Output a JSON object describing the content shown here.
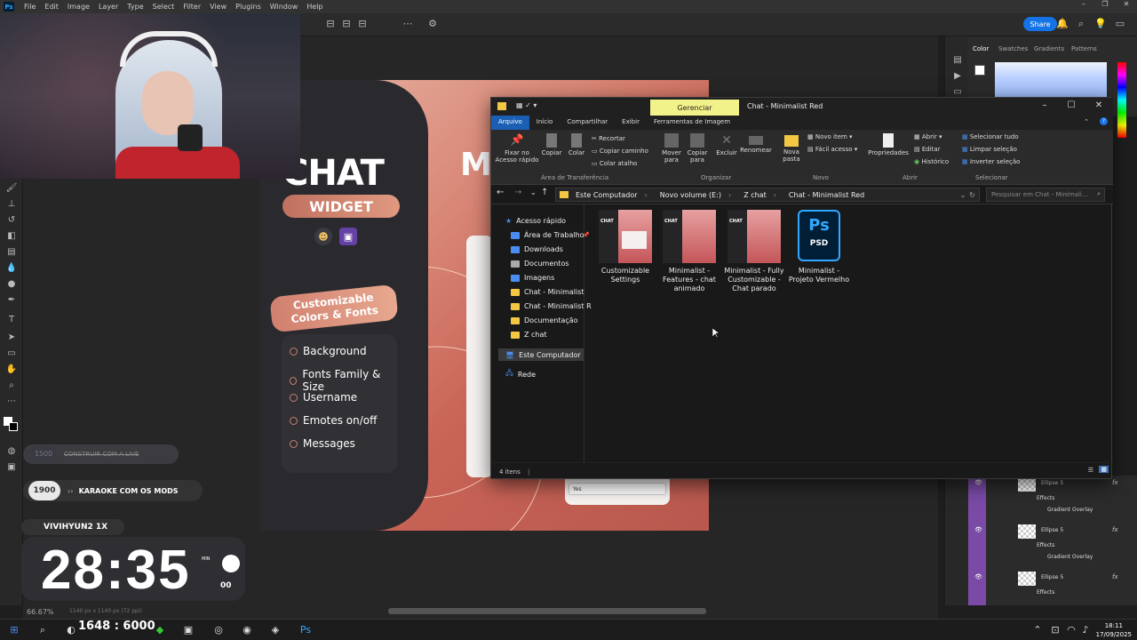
{
  "photoshop": {
    "menu": [
      "File",
      "Edit",
      "Image",
      "Layer",
      "Type",
      "Select",
      "Filter",
      "View",
      "Plugins",
      "Window",
      "Help"
    ],
    "logo": "Ps",
    "share_label": "Share",
    "panel_tabs": [
      "Color",
      "Swatches",
      "Gradients",
      "Patterns"
    ],
    "status_zoom": "66.67%",
    "status_doc": "1140 px x 1140 px (72 ppi)",
    "layers": [
      {
        "name": "Ellipse 5",
        "fx": "fx",
        "effects": "Effects",
        "effect_item": "Gradient Overlay"
      },
      {
        "name": "Ellipse 5",
        "fx": "fx",
        "effects": "Effects",
        "effect_item": "Gradient Overlay"
      },
      {
        "name": "Ellipse 5",
        "fx": "fx",
        "effects": "Effects",
        "effect_item": "Gradient Overlay"
      }
    ]
  },
  "artboard": {
    "title": "CHAT",
    "badge": "WIDGET",
    "partial_title": "M",
    "custom_badge_line1": "Customizable",
    "custom_badge_line2": "Colors & Fonts",
    "features": [
      "Background",
      "Fonts Family & Size",
      "Username",
      "Emotes on/off",
      "Messages"
    ],
    "select_value": "Yes"
  },
  "stream": {
    "goal1_number": "1500",
    "goal1_text": "CONSTRUIR COM A LIVE",
    "goal2_number": "1900",
    "goal2_text": "KARAOKE COM OS MODS",
    "timer_label": "VIVIHYUN2 1X",
    "timer_value": "28:35",
    "timer_min_label": "MIN",
    "timer_seconds": "00"
  },
  "explorer": {
    "title": "Chat - Minimalist Red",
    "manage_tab": "Gerenciar",
    "tabs": [
      "Arquivo",
      "Início",
      "Compartilhar",
      "Exibir",
      "Ferramentas de Imagem"
    ],
    "ribbon": {
      "pin": "Fixar no Acesso rápido",
      "copy": "Copiar",
      "paste": "Colar",
      "cut": "Recortar",
      "copy_path": "Copiar caminho",
      "paste_shortcut": "Colar atalho",
      "move_to": "Mover para",
      "copy_to": "Copiar para",
      "delete": "Excluir",
      "rename": "Renomear",
      "new_folder": "Nova pasta",
      "new_item": "Novo item",
      "easy_access": "Fácil acesso",
      "properties": "Propriedades",
      "open": "Abrir",
      "edit": "Editar",
      "history": "Histórico",
      "select_all": "Selecionar tudo",
      "clear_selection": "Limpar seleção",
      "invert_selection": "Inverter seleção",
      "groups": [
        "Área de Transferência",
        "Organizar",
        "Novo",
        "Abrir",
        "Selecionar"
      ]
    },
    "breadcrumb": [
      "Este Computador",
      "Novo volume (E:)",
      "Z chat",
      "Chat - Minimalist Red"
    ],
    "search_placeholder": "Pesquisar em Chat - Minimali...",
    "nav": {
      "quick_access": "Acesso rápido",
      "items": [
        "Área de Trabalho",
        "Downloads",
        "Documentos",
        "Imagens",
        "Chat - Minimalist",
        "Chat - Minimalist R",
        "Documentação",
        "Z chat"
      ],
      "this_pc": "Este Computador",
      "network": "Rede"
    },
    "files": [
      {
        "name": "Customizable Settings",
        "type": "image"
      },
      {
        "name": "Minimalist - Features - chat animado",
        "type": "image"
      },
      {
        "name": "Minimalist - Fully Customizable - Chat parado",
        "type": "image"
      },
      {
        "name": "Minimalist - Projeto Vermelho",
        "type": "psd"
      }
    ],
    "psd_icon_text": "Ps",
    "psd_icon_sub": "PSD",
    "thumb_label": "CHAT",
    "status_count": "4 itens"
  },
  "taskbar": {
    "counter": "1648 : 6000",
    "time": "18:11",
    "date": "17/09/2025"
  },
  "colors": {
    "accent": "#1a5fb4",
    "manage_tab": "#f2f28a",
    "layer_bar": "#7a4aa6",
    "share": "#1473e6"
  }
}
